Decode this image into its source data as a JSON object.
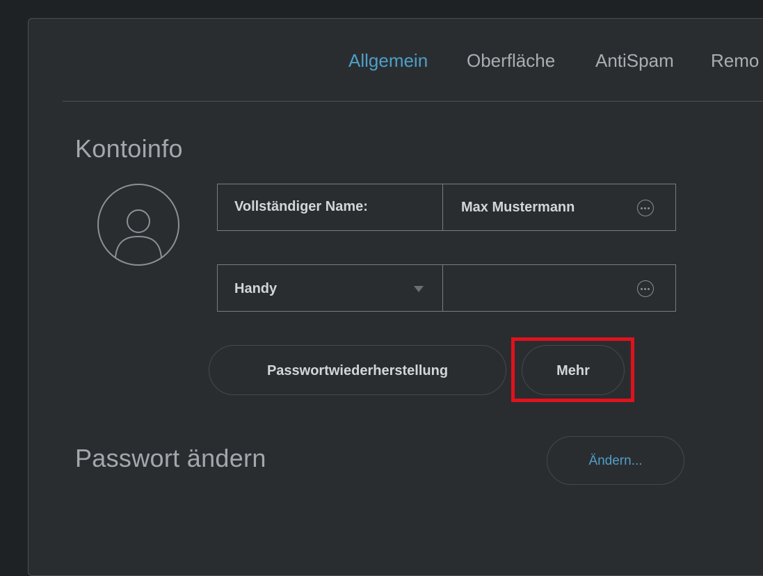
{
  "tabs": [
    {
      "label": "Allgemein",
      "active": true
    },
    {
      "label": "Oberfläche",
      "active": false
    },
    {
      "label": "AntiSpam",
      "active": false
    },
    {
      "label": "Remo",
      "active": false
    }
  ],
  "kontoinfo": {
    "title": "Kontoinfo",
    "avatar_icon": "user-avatar-icon",
    "name_field": {
      "label": "Vollständiger Name:",
      "value": "Max Mustermann",
      "action_icon": "more-circle-icon"
    },
    "phone_field": {
      "type_selected": "Handy",
      "value": "",
      "action_icon": "more-circle-icon"
    },
    "buttons": {
      "recovery_label": "Passwortwiederherstellung",
      "more_label": "Mehr"
    }
  },
  "password": {
    "title": "Passwort ändern",
    "change_label": "Ändern..."
  },
  "colors": {
    "background": "#2a2d30",
    "accent": "#4f9fc8",
    "highlight": "#e0121d"
  }
}
